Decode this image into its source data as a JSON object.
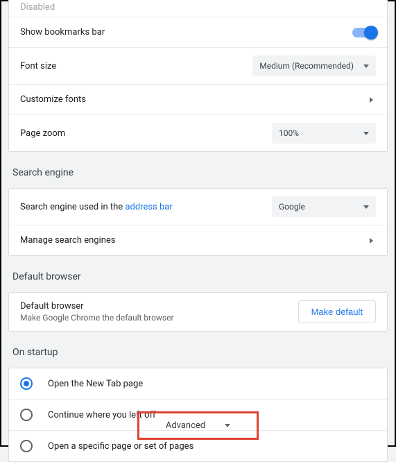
{
  "appearance": {
    "disabled_label": "Disabled",
    "show_bookmarks_label": "Show bookmarks bar",
    "font_size_label": "Font size",
    "font_size_value": "Medium (Recommended)",
    "customize_fonts_label": "Customize fonts",
    "page_zoom_label": "Page zoom",
    "page_zoom_value": "100%"
  },
  "search_engine": {
    "section_title": "Search engine",
    "used_in_prefix": "Search engine used in the ",
    "address_bar_link": "address bar",
    "selected_engine": "Google",
    "manage_label": "Manage search engines"
  },
  "default_browser": {
    "section_title": "Default browser",
    "row_title": "Default browser",
    "row_subtitle": "Make Google Chrome the default browser",
    "button_label": "Make default"
  },
  "on_startup": {
    "section_title": "On startup",
    "opt_new_tab": "Open the New Tab page",
    "opt_continue": "Continue where you left off",
    "opt_specific": "Open a specific page or set of pages"
  },
  "advanced_label": "Advanced"
}
